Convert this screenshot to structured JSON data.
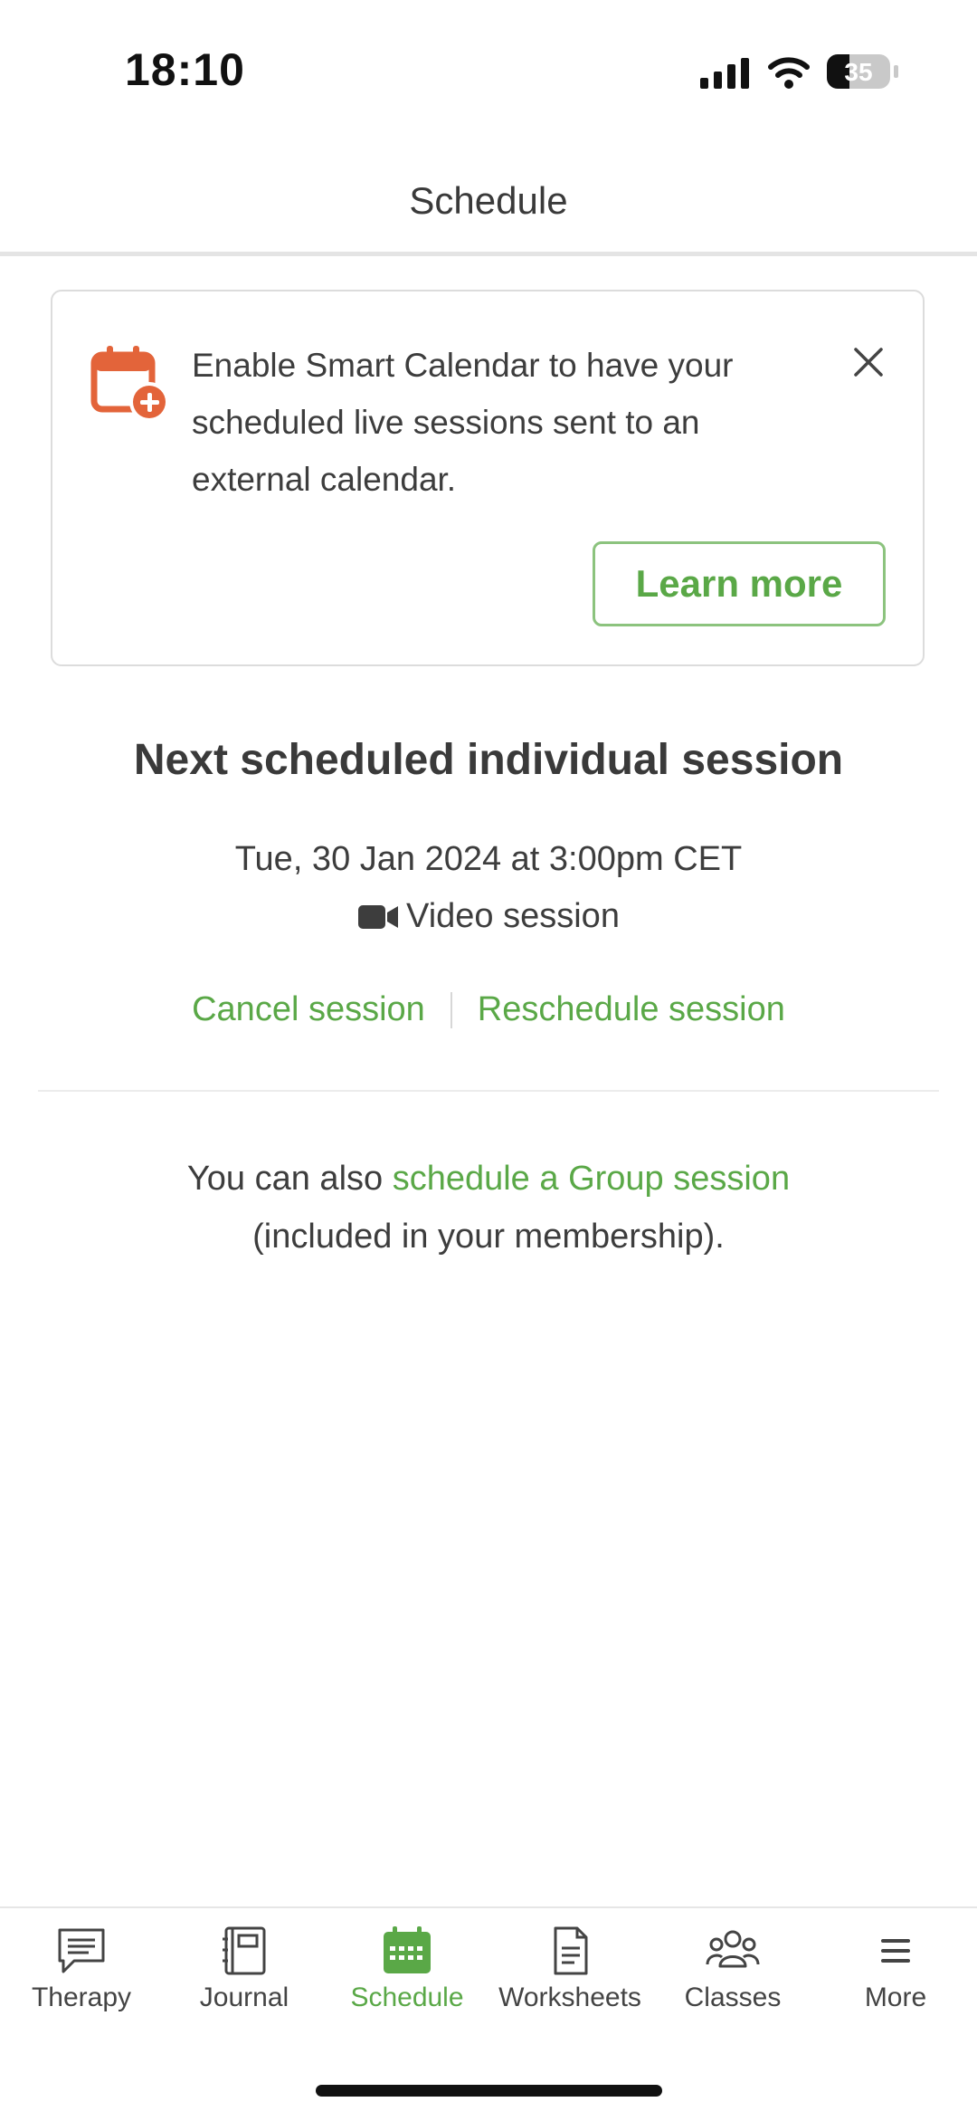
{
  "status_bar": {
    "time": "18:10",
    "battery_level": "35",
    "battery_fraction": 0.35
  },
  "header": {
    "title": "Schedule"
  },
  "banner": {
    "icon": "calendar-plus-icon",
    "text": "Enable Smart Calendar to have your scheduled live sessions sent to an external calendar.",
    "close_icon": "close-icon",
    "learn_more_label": "Learn more"
  },
  "session": {
    "heading": "Next scheduled individual session",
    "date": "Tue, 30 Jan 2024 at 3:00pm CET",
    "type_icon": "video-camera-icon",
    "type_label": "Video session",
    "cancel_label": "Cancel session",
    "reschedule_label": "Reschedule session"
  },
  "group": {
    "prefix": "You can also ",
    "link": "schedule a Group session",
    "suffix": "(included in your membership)."
  },
  "tabs": [
    {
      "label": "Therapy",
      "icon": "chat-icon",
      "active": false
    },
    {
      "label": "Journal",
      "icon": "journal-icon",
      "active": false
    },
    {
      "label": "Schedule",
      "icon": "calendar-icon",
      "active": true
    },
    {
      "label": "Worksheets",
      "icon": "document-icon",
      "active": false
    },
    {
      "label": "Classes",
      "icon": "group-icon",
      "active": false
    },
    {
      "label": "More",
      "icon": "menu-icon",
      "active": false
    }
  ],
  "colors": {
    "accent_green": "#5aa847",
    "banner_icon_orange": "#e3643a",
    "text_dark": "#3d3d3d"
  }
}
